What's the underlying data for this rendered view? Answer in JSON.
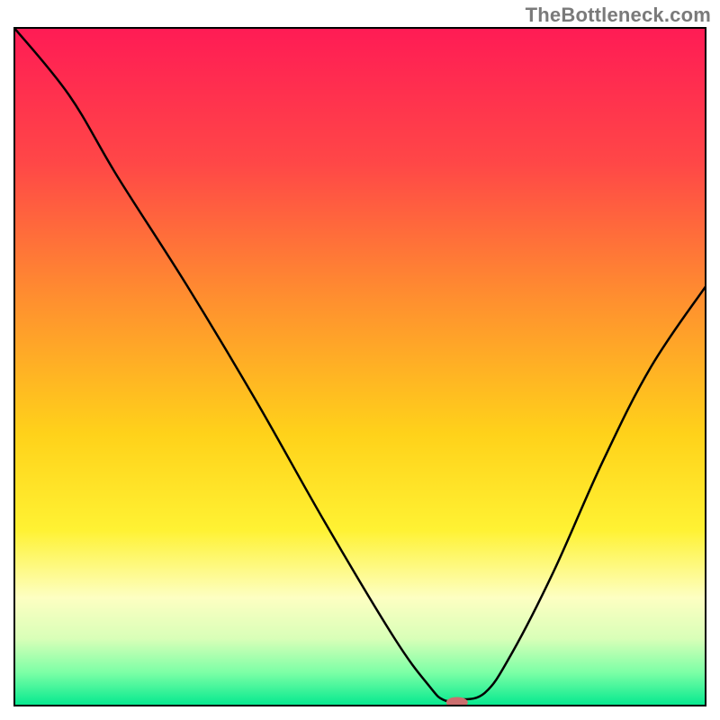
{
  "watermark": "TheBottleneck.com",
  "chart_data": {
    "type": "line",
    "title": "",
    "xlabel": "",
    "ylabel": "",
    "xlim": [
      0,
      100
    ],
    "ylim": [
      0,
      100
    ],
    "grid": false,
    "legend": false,
    "background_gradient_stops": [
      {
        "offset": 0.0,
        "color": "#ff1b55"
      },
      {
        "offset": 0.2,
        "color": "#ff4747"
      },
      {
        "offset": 0.4,
        "color": "#ff8f2f"
      },
      {
        "offset": 0.6,
        "color": "#ffd21a"
      },
      {
        "offset": 0.74,
        "color": "#fff233"
      },
      {
        "offset": 0.84,
        "color": "#fdffc2"
      },
      {
        "offset": 0.9,
        "color": "#d9ffb8"
      },
      {
        "offset": 0.95,
        "color": "#7cffa6"
      },
      {
        "offset": 1.0,
        "color": "#00e88e"
      }
    ],
    "series": [
      {
        "name": "bottleneck-curve",
        "x": [
          0,
          8,
          15,
          25,
          35,
          45,
          55,
          60,
          62,
          64,
          68,
          72,
          78,
          85,
          92,
          100
        ],
        "y": [
          100,
          90,
          78,
          62,
          45,
          27,
          10,
          3,
          1,
          1,
          2,
          8,
          20,
          36,
          50,
          62
        ]
      }
    ],
    "marker": {
      "name": "optimal-point",
      "x": 64,
      "y": 0.6,
      "color": "#cc6e6e",
      "rx": 12,
      "ry": 6
    },
    "axes_color": "#000000"
  }
}
